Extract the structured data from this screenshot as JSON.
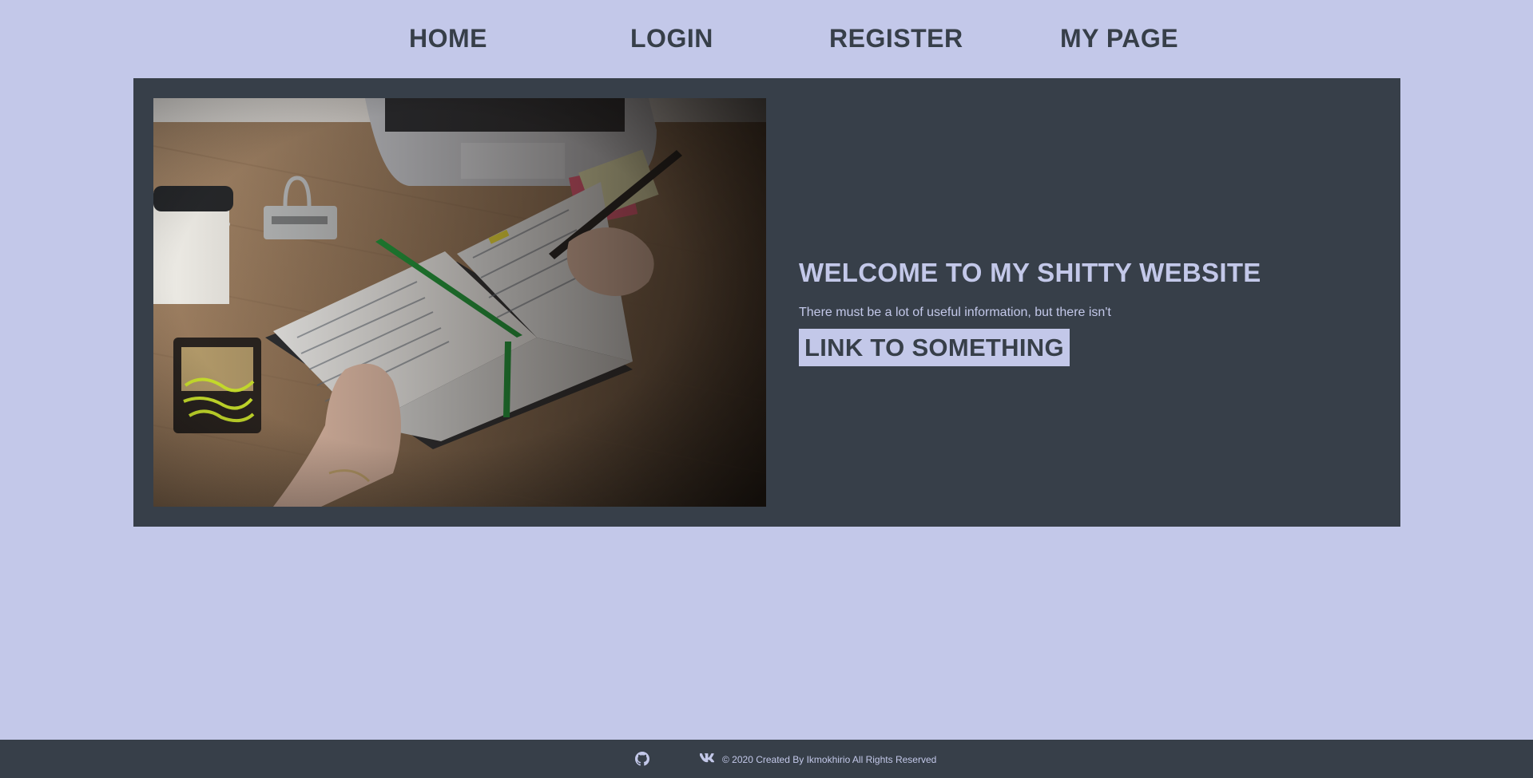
{
  "nav": {
    "items": [
      {
        "label": "HOME"
      },
      {
        "label": "LOGIN"
      },
      {
        "label": "REGISTER"
      },
      {
        "label": "MY PAGE"
      }
    ]
  },
  "hero": {
    "image_alt": "desk with notebook, coffee cup, laptop and hands writing",
    "title": "WELCOME TO MY SHITTY WEBSITE",
    "subtitle": "There must be a lot of useful information, but there isn't",
    "link_label": "LINK TO SOMETHING"
  },
  "footer": {
    "icons": [
      "github-icon",
      "vk-icon"
    ],
    "copyright": "© 2020 Created By Ikmokhirio All Rights Reserved"
  },
  "colors": {
    "background": "#c3c8e9",
    "panel": "#373f49",
    "accent": "#c3c8e9"
  }
}
